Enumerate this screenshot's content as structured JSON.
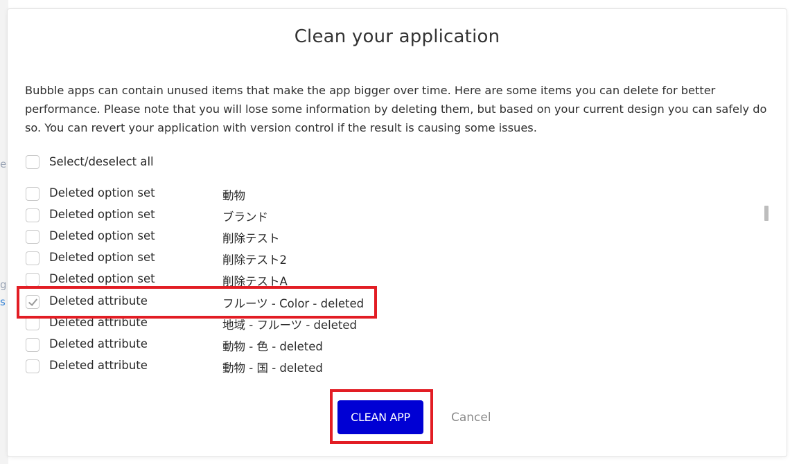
{
  "background": {
    "fragments": [
      "e",
      "g",
      "s"
    ]
  },
  "dialog": {
    "title": "Clean your application",
    "description": "Bubble apps can contain unused items that make the app bigger over time. Here are some items you can delete for better performance. Please note that you will lose some information by deleting them, but based on your current design you can safely do so. You can revert your application with version control if the result is causing some issues.",
    "select_all": {
      "label": "Select/deselect all",
      "checked": false
    },
    "items": [
      {
        "type": "Deleted option set",
        "name": "動物",
        "checked": false
      },
      {
        "type": "Deleted option set",
        "name": "ブランド",
        "checked": false
      },
      {
        "type": "Deleted option set",
        "name": "削除テスト",
        "checked": false
      },
      {
        "type": "Deleted option set",
        "name": "削除テスト2",
        "checked": false
      },
      {
        "type": "Deleted option set",
        "name": "削除テストA",
        "checked": false
      },
      {
        "type": "Deleted attribute",
        "name": "フルーツ - Color - deleted",
        "checked": true
      },
      {
        "type": "Deleted attribute",
        "name": "地域 - フルーツ - deleted",
        "checked": false
      },
      {
        "type": "Deleted attribute",
        "name": "動物 - 色 - deleted",
        "checked": false
      },
      {
        "type": "Deleted attribute",
        "name": "動物 - 国 - deleted",
        "checked": false
      }
    ],
    "buttons": {
      "clean": "CLEAN APP",
      "cancel": "Cancel"
    }
  },
  "colors": {
    "primary_button": "#0000d4",
    "highlight": "#e21d24",
    "cancel_text": "#8a8a8a"
  }
}
